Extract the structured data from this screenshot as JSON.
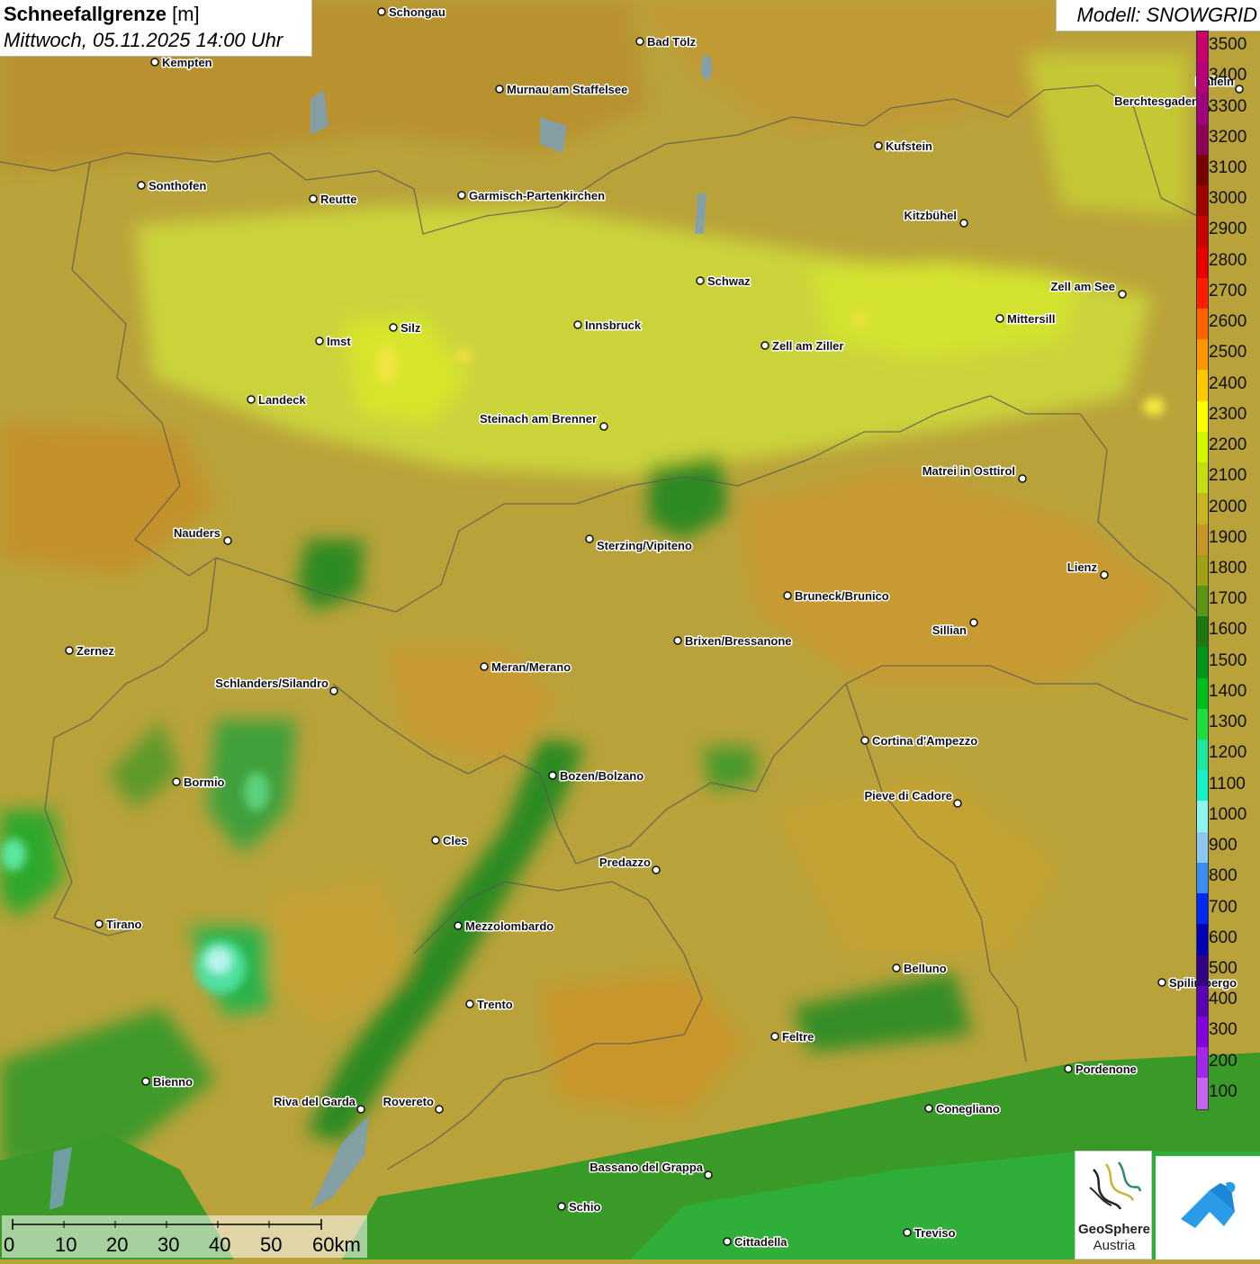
{
  "header": {
    "title_bold": "Schneefallgrenze",
    "title_unit": "[m]",
    "datetime": "Mittwoch, 05.11.2025 14:00 Uhr"
  },
  "model": {
    "label": "Modell: SNOWGRID"
  },
  "legend": {
    "items": [
      {
        "label": "3500",
        "color": "#c8006e"
      },
      {
        "label": "3400",
        "color": "#b4007a"
      },
      {
        "label": "3300",
        "color": "#a0007e"
      },
      {
        "label": "3200",
        "color": "#8c0058"
      },
      {
        "label": "3100",
        "color": "#780000"
      },
      {
        "label": "3000",
        "color": "#a00000"
      },
      {
        "label": "2900",
        "color": "#c80000"
      },
      {
        "label": "2800",
        "color": "#e60000"
      },
      {
        "label": "2700",
        "color": "#ff1e00"
      },
      {
        "label": "2600",
        "color": "#ff6400"
      },
      {
        "label": "2500",
        "color": "#ff9600"
      },
      {
        "label": "2400",
        "color": "#ffc800"
      },
      {
        "label": "2300",
        "color": "#ffff00"
      },
      {
        "label": "2200",
        "color": "#d2f500"
      },
      {
        "label": "2100",
        "color": "#c3dc14"
      },
      {
        "label": "2000",
        "color": "#c8b41e"
      },
      {
        "label": "1900",
        "color": "#c89628"
      },
      {
        "label": "1800",
        "color": "#a0a014"
      },
      {
        "label": "1700",
        "color": "#5a9614"
      },
      {
        "label": "1600",
        "color": "#1e7814"
      },
      {
        "label": "1500",
        "color": "#00961e"
      },
      {
        "label": "1400",
        "color": "#00be1e"
      },
      {
        "label": "1300",
        "color": "#1edc3c"
      },
      {
        "label": "1200",
        "color": "#1ee6a0"
      },
      {
        "label": "1100",
        "color": "#14f0c8"
      },
      {
        "label": "1000",
        "color": "#8cf5f0"
      },
      {
        "label": "900",
        "color": "#8cc8f0"
      },
      {
        "label": "800",
        "color": "#3c8cf0"
      },
      {
        "label": "700",
        "color": "#0028f0"
      },
      {
        "label": "600",
        "color": "#0000b4"
      },
      {
        "label": "500",
        "color": "#320082"
      },
      {
        "label": "400",
        "color": "#5a00b4"
      },
      {
        "label": "300",
        "color": "#8200dc"
      },
      {
        "label": "200",
        "color": "#a028e6"
      },
      {
        "label": "100",
        "color": "#c864f0"
      }
    ]
  },
  "cities": [
    {
      "name": "Kempten"
    },
    {
      "name": "Schongau"
    },
    {
      "name": "Bad Tölz"
    },
    {
      "name": "Murnau am Staffelsee"
    },
    {
      "name": "Berchtesgaden"
    },
    {
      "name": "Kufstein"
    },
    {
      "name": "Sonthofen"
    },
    {
      "name": "Reutte"
    },
    {
      "name": "Garmisch-Partenkirchen"
    },
    {
      "name": "Kitzbühel"
    },
    {
      "name": "Schwaz"
    },
    {
      "name": "Zell am See"
    },
    {
      "name": "Mittersill"
    },
    {
      "name": "Innsbruck"
    },
    {
      "name": "Imst"
    },
    {
      "name": "Silz"
    },
    {
      "name": "Zell am Ziller"
    },
    {
      "name": "Landeck"
    },
    {
      "name": "Steinach am Brenner"
    },
    {
      "name": "Matrei in Osttirol"
    },
    {
      "name": "Nauders"
    },
    {
      "name": "Sterzing/Vipiteno"
    },
    {
      "name": "Lienz"
    },
    {
      "name": "Bruneck/Brunico"
    },
    {
      "name": "Sillian"
    },
    {
      "name": "Brixen/Bressanone"
    },
    {
      "name": "Zernez"
    },
    {
      "name": "Meran/Merano"
    },
    {
      "name": "Schlanders/Silandro"
    },
    {
      "name": "Cortina d'Ampezzo"
    },
    {
      "name": "Bozen/Bolzano"
    },
    {
      "name": "Bormio"
    },
    {
      "name": "Pieve di Cadore"
    },
    {
      "name": "Cles"
    },
    {
      "name": "Predazzo"
    },
    {
      "name": "Tirano"
    },
    {
      "name": "Mezzolombardo"
    },
    {
      "name": "Belluno"
    },
    {
      "name": "Spilimbergo"
    },
    {
      "name": "Trento"
    },
    {
      "name": "Feltre"
    },
    {
      "name": "Pordenone"
    },
    {
      "name": "Bienno"
    },
    {
      "name": "Riva del Garda"
    },
    {
      "name": "Rovereto"
    },
    {
      "name": "Conegliano"
    },
    {
      "name": "Bassano del Grappa"
    },
    {
      "name": "Schio"
    },
    {
      "name": "Cittadella"
    },
    {
      "name": "Treviso"
    },
    {
      "name": "Hallein"
    }
  ],
  "scale": {
    "labels": [
      "0",
      "10",
      "20",
      "30",
      "40",
      "50",
      "60km"
    ]
  },
  "logos": {
    "geosphere_name": "GeoSphere",
    "geosphere_sub": "Austria"
  }
}
